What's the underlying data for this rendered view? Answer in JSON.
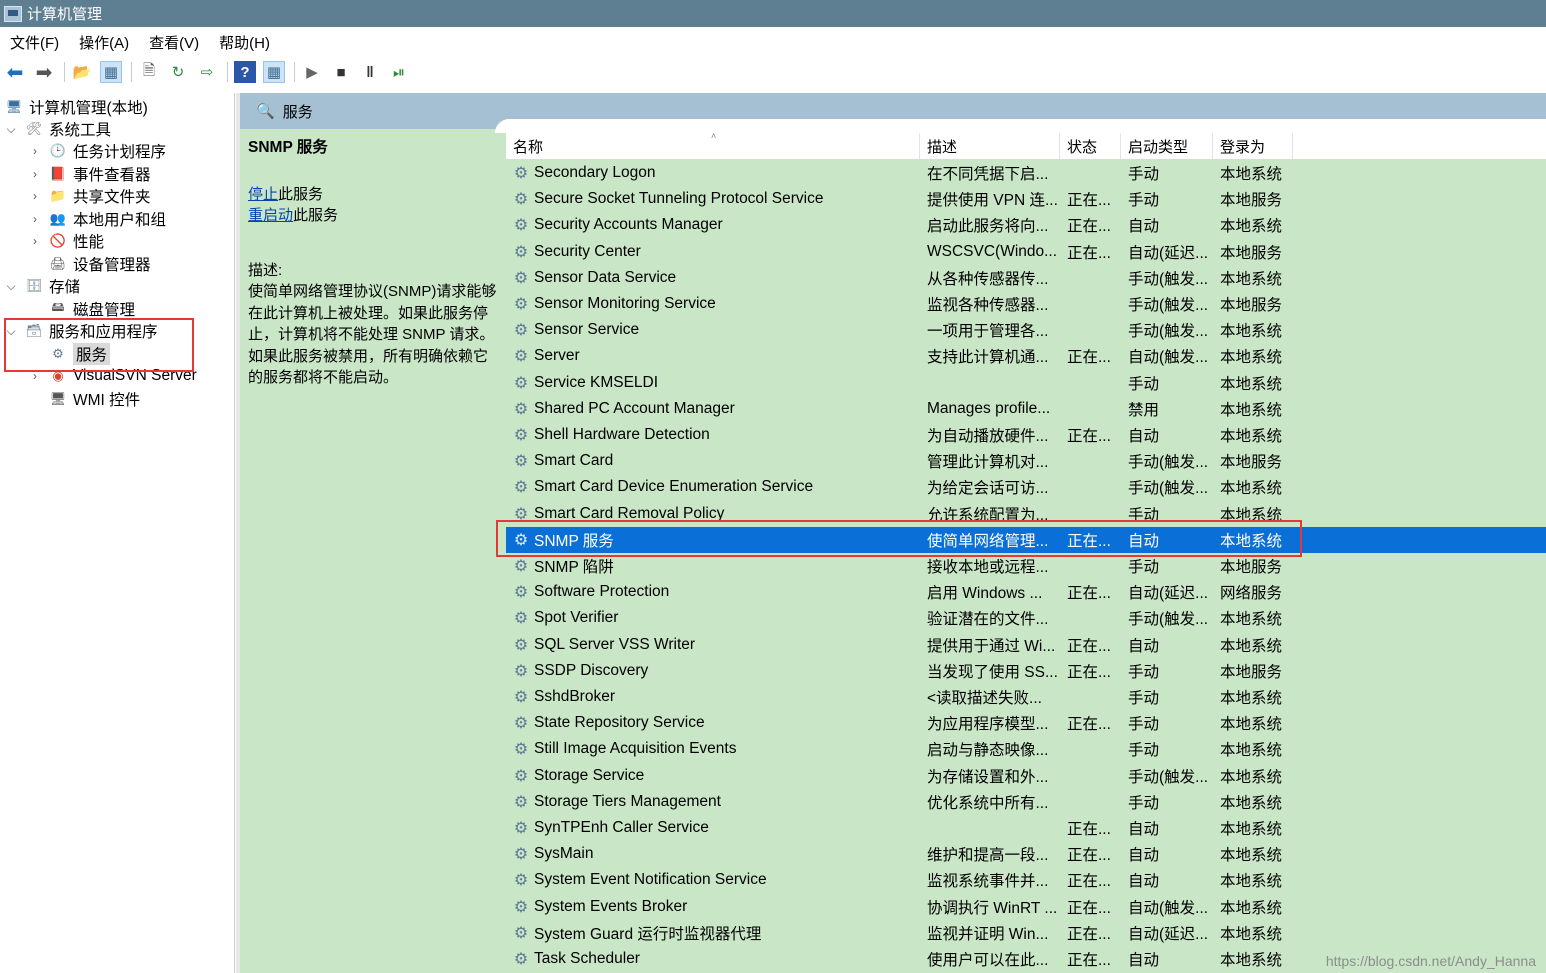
{
  "window": {
    "title": "计算机管理"
  },
  "menu": [
    "文件(F)",
    "操作(A)",
    "查看(V)",
    "帮助(H)"
  ],
  "toolbar_icons": [
    "back-arrow-icon",
    "forward-arrow-icon",
    "up-folder-icon",
    "show-hide-tree-icon",
    "properties-icon",
    "refresh-icon",
    "export-list-icon",
    "help-icon",
    "show-hide-action-pane-icon",
    "start-service-icon",
    "stop-service-icon",
    "pause-service-icon",
    "resume-service-icon"
  ],
  "tree": {
    "root": "计算机管理(本地)",
    "system_tools": "系统工具",
    "task_scheduler": "任务计划程序",
    "event_viewer": "事件查看器",
    "shared_folders": "共享文件夹",
    "local_users": "本地用户和组",
    "performance": "性能",
    "device_manager": "设备管理器",
    "storage": "存储",
    "disk_management": "磁盘管理",
    "services_apps": "服务和应用程序",
    "services": "服务",
    "visualsvn": "VisualSVN Server",
    "wmi": "WMI 控件"
  },
  "main": {
    "header": "服务",
    "detail": {
      "service_name": "SNMP 服务",
      "stop_link": "停止",
      "stop_suffix": "此服务",
      "restart_link": "重启动",
      "restart_suffix": "此服务",
      "desc_label": "描述:",
      "desc_text": "使简单网络管理协议(SNMP)请求能够在此计算机上被处理。如果此服务停止，计算机将不能处理 SNMP 请求。如果此服务被禁用，所有明确依赖它的服务都将不能启动。"
    },
    "columns": {
      "name": "名称",
      "desc": "描述",
      "status": "状态",
      "startup": "启动类型",
      "logon": "登录为"
    },
    "rows": [
      {
        "name": "Secondary Logon",
        "desc": "在不同凭据下启...",
        "status": "",
        "startup": "手动",
        "logon": "本地系统"
      },
      {
        "name": "Secure Socket Tunneling Protocol Service",
        "desc": "提供使用 VPN 连...",
        "status": "正在...",
        "startup": "手动",
        "logon": "本地服务"
      },
      {
        "name": "Security Accounts Manager",
        "desc": "启动此服务将向...",
        "status": "正在...",
        "startup": "自动",
        "logon": "本地系统"
      },
      {
        "name": "Security Center",
        "desc": "WSCSVC(Windo...",
        "status": "正在...",
        "startup": "自动(延迟...",
        "logon": "本地服务"
      },
      {
        "name": "Sensor Data Service",
        "desc": "从各种传感器传...",
        "status": "",
        "startup": "手动(触发...",
        "logon": "本地系统"
      },
      {
        "name": "Sensor Monitoring Service",
        "desc": "监视各种传感器...",
        "status": "",
        "startup": "手动(触发...",
        "logon": "本地服务"
      },
      {
        "name": "Sensor Service",
        "desc": "一项用于管理各...",
        "status": "",
        "startup": "手动(触发...",
        "logon": "本地系统"
      },
      {
        "name": "Server",
        "desc": "支持此计算机通...",
        "status": "正在...",
        "startup": "自动(触发...",
        "logon": "本地系统"
      },
      {
        "name": "Service KMSELDI",
        "desc": "",
        "status": "",
        "startup": "手动",
        "logon": "本地系统"
      },
      {
        "name": "Shared PC Account Manager",
        "desc": "Manages profile...",
        "status": "",
        "startup": "禁用",
        "logon": "本地系统"
      },
      {
        "name": "Shell Hardware Detection",
        "desc": "为自动播放硬件...",
        "status": "正在...",
        "startup": "自动",
        "logon": "本地系统"
      },
      {
        "name": "Smart Card",
        "desc": "管理此计算机对...",
        "status": "",
        "startup": "手动(触发...",
        "logon": "本地服务"
      },
      {
        "name": "Smart Card Device Enumeration Service",
        "desc": "为给定会话可访...",
        "status": "",
        "startup": "手动(触发...",
        "logon": "本地系统"
      },
      {
        "name": "Smart Card Removal Policy",
        "desc": "允许系统配置为...",
        "status": "",
        "startup": "手动",
        "logon": "本地系统"
      },
      {
        "name": "SNMP 服务",
        "desc": "使简单网络管理...",
        "status": "正在...",
        "startup": "自动",
        "logon": "本地系统"
      },
      {
        "name": "SNMP 陷阱",
        "desc": "接收本地或远程...",
        "status": "",
        "startup": "手动",
        "logon": "本地服务"
      },
      {
        "name": "Software Protection",
        "desc": "启用 Windows ...",
        "status": "正在...",
        "startup": "自动(延迟...",
        "logon": "网络服务"
      },
      {
        "name": "Spot Verifier",
        "desc": "验证潜在的文件...",
        "status": "",
        "startup": "手动(触发...",
        "logon": "本地系统"
      },
      {
        "name": "SQL Server VSS Writer",
        "desc": "提供用于通过 Wi...",
        "status": "正在...",
        "startup": "自动",
        "logon": "本地系统"
      },
      {
        "name": "SSDP Discovery",
        "desc": "当发现了使用 SS...",
        "status": "正在...",
        "startup": "手动",
        "logon": "本地服务"
      },
      {
        "name": "SshdBroker",
        "desc": "<读取描述失败...",
        "status": "",
        "startup": "手动",
        "logon": "本地系统"
      },
      {
        "name": "State Repository Service",
        "desc": "为应用程序模型...",
        "status": "正在...",
        "startup": "手动",
        "logon": "本地系统"
      },
      {
        "name": "Still Image Acquisition Events",
        "desc": "启动与静态映像...",
        "status": "",
        "startup": "手动",
        "logon": "本地系统"
      },
      {
        "name": "Storage Service",
        "desc": "为存储设置和外...",
        "status": "",
        "startup": "手动(触发...",
        "logon": "本地系统"
      },
      {
        "name": "Storage Tiers Management",
        "desc": "优化系统中所有...",
        "status": "",
        "startup": "手动",
        "logon": "本地系统"
      },
      {
        "name": "SynTPEnh Caller Service",
        "desc": "",
        "status": "正在...",
        "startup": "自动",
        "logon": "本地系统"
      },
      {
        "name": "SysMain",
        "desc": "维护和提高一段...",
        "status": "正在...",
        "startup": "自动",
        "logon": "本地系统"
      },
      {
        "name": "System Event Notification Service",
        "desc": "监视系统事件并...",
        "status": "正在...",
        "startup": "自动",
        "logon": "本地系统"
      },
      {
        "name": "System Events Broker",
        "desc": "协调执行 WinRT ...",
        "status": "正在...",
        "startup": "自动(触发...",
        "logon": "本地系统"
      },
      {
        "name": "System Guard 运行时监视器代理",
        "desc": "监视并证明 Win...",
        "status": "正在...",
        "startup": "自动(延迟...",
        "logon": "本地系统"
      },
      {
        "name": "Task Scheduler",
        "desc": "使用户可以在此...",
        "status": "正在...",
        "startup": "自动",
        "logon": "本地系统"
      }
    ]
  },
  "watermark": "https://blog.csdn.net/Andy_Hanna",
  "colors": {
    "title_bar": "#5e7e91",
    "pane_bg": "#c9e6c6",
    "header_bg": "#a5c0d2",
    "selection": "#0a6fd6",
    "highlight_box": "#e53935"
  }
}
